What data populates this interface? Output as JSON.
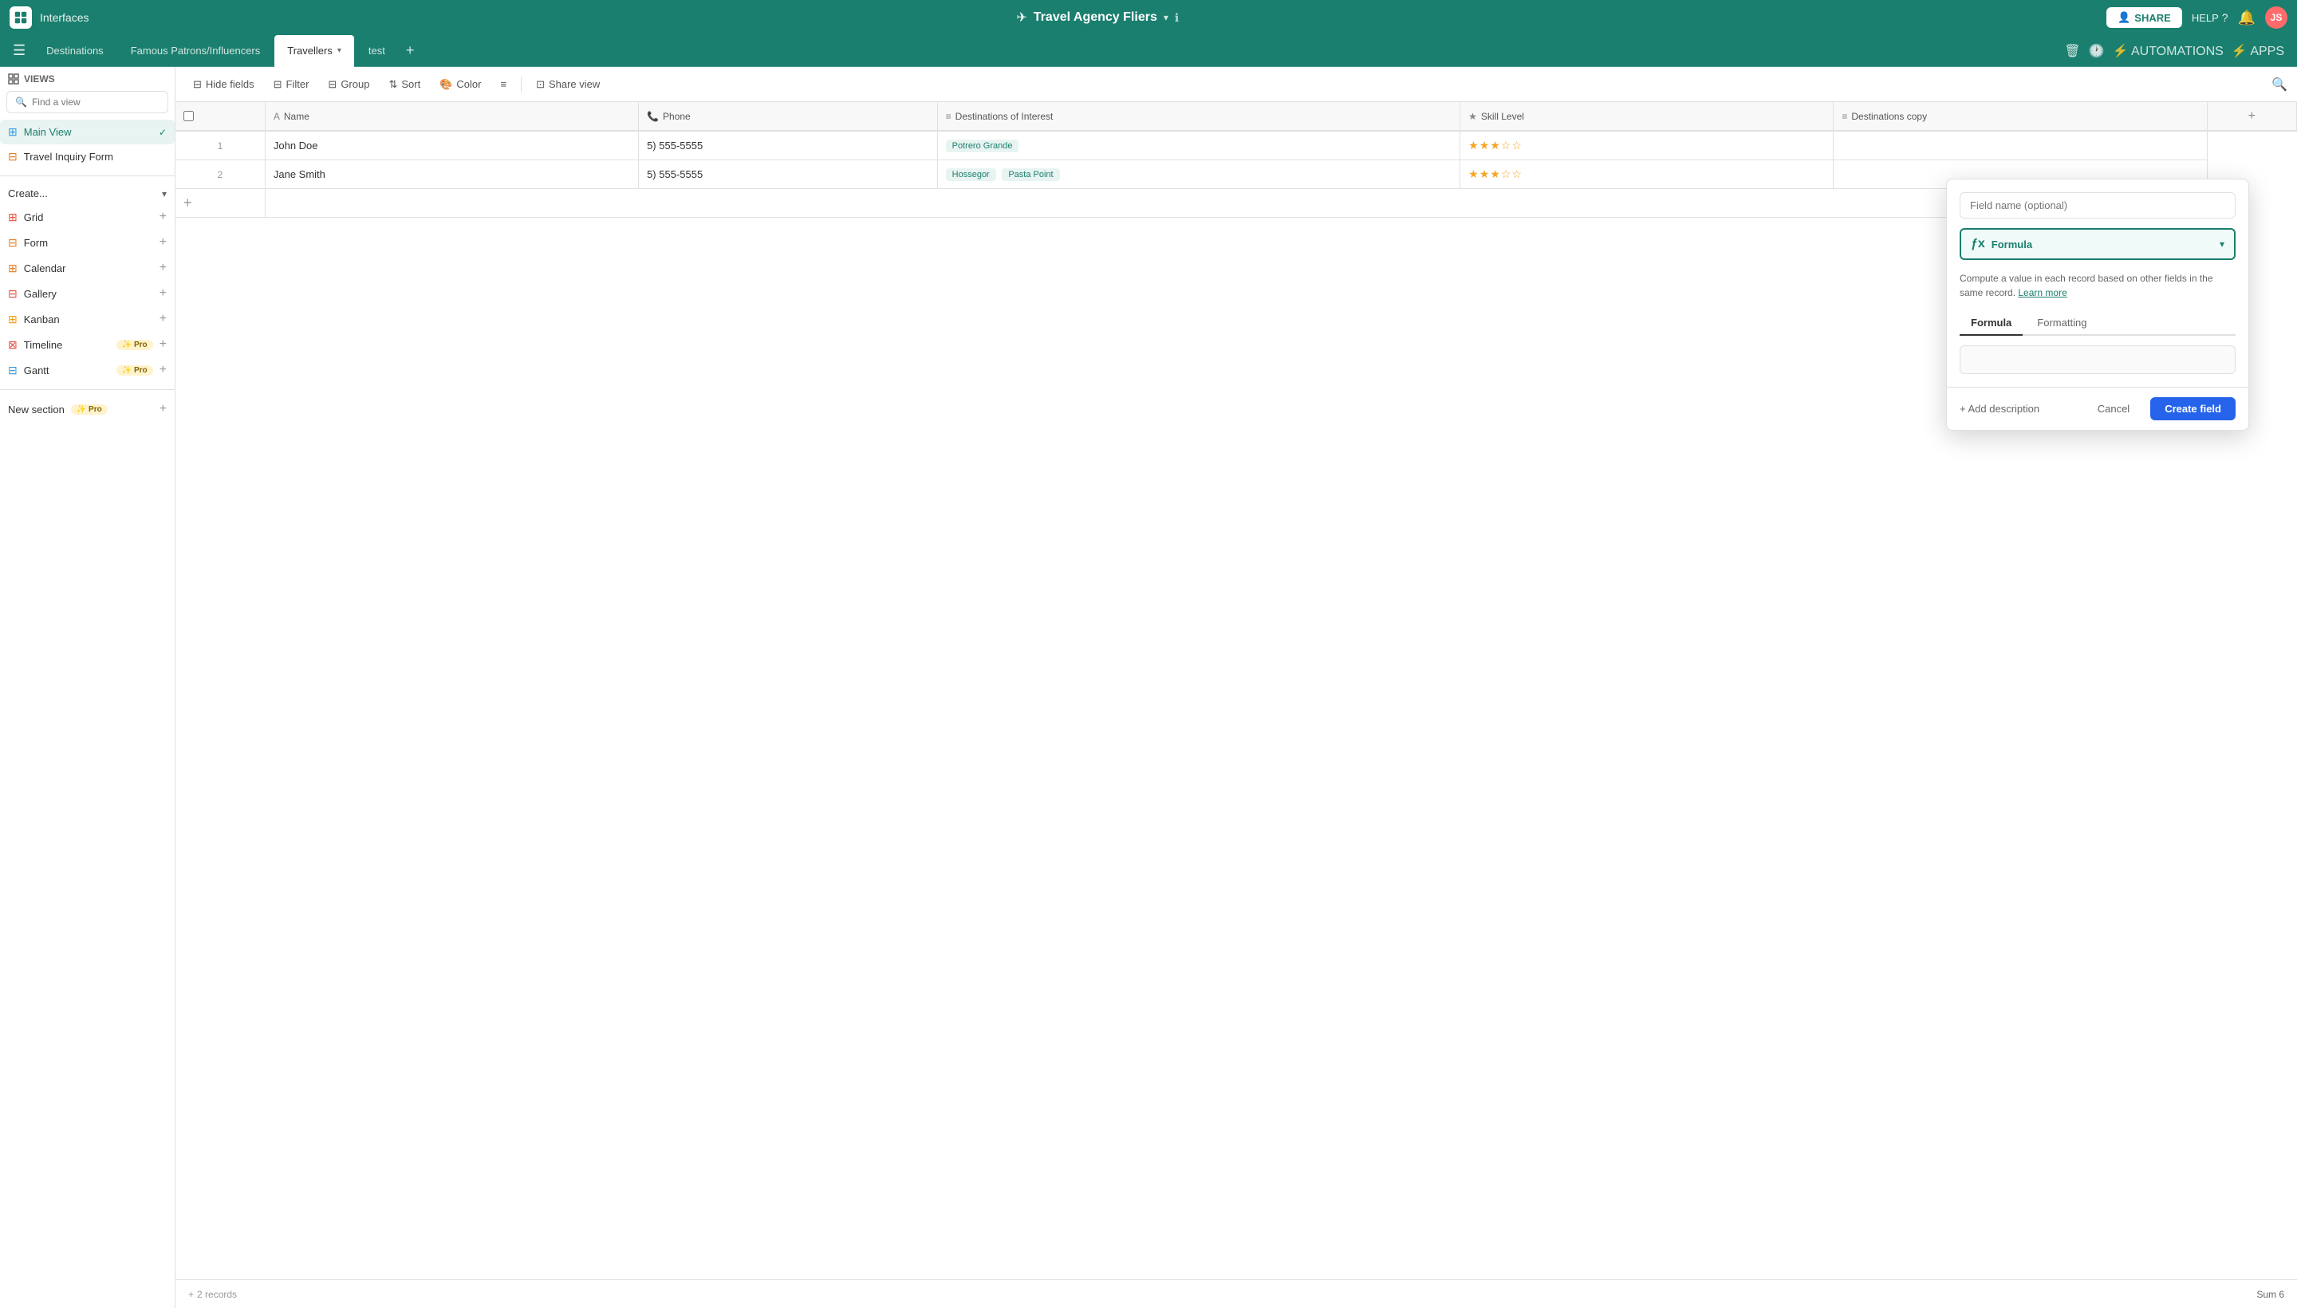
{
  "app": {
    "name": "Interfaces",
    "project_title": "Travel Agency Fliers",
    "info_icon": "ℹ",
    "plane_icon": "✈"
  },
  "topbar": {
    "share_label": "SHARE",
    "help_label": "HELP",
    "avatar_initials": "JS"
  },
  "tabs": [
    {
      "id": "destinations",
      "label": "Destinations",
      "active": false
    },
    {
      "id": "famous",
      "label": "Famous Patrons/Influencers",
      "active": false
    },
    {
      "id": "travellers",
      "label": "Travellers",
      "active": true,
      "has_dropdown": true
    },
    {
      "id": "test",
      "label": "test",
      "active": false
    }
  ],
  "toolbar": {
    "views_label": "VIEWS",
    "main_view_label": "Main View",
    "hide_fields_label": "Hide fields",
    "filter_label": "Filter",
    "group_label": "Group",
    "sort_label": "Sort",
    "color_label": "Color",
    "share_view_label": "Share view"
  },
  "sidebar": {
    "find_placeholder": "Find a view",
    "views": [
      {
        "id": "main-view",
        "label": "Main View",
        "type": "grid",
        "active": true
      },
      {
        "id": "inquiry-form",
        "label": "Travel Inquiry Form",
        "type": "form",
        "active": false
      }
    ],
    "create_label": "Create...",
    "create_items": [
      {
        "id": "grid",
        "label": "Grid",
        "color": "#e74c3c"
      },
      {
        "id": "form",
        "label": "Form",
        "color": "#e67e22"
      },
      {
        "id": "calendar",
        "label": "Calendar",
        "color": "#e67e22"
      },
      {
        "id": "gallery",
        "label": "Gallery",
        "color": "#e74c3c"
      },
      {
        "id": "kanban",
        "label": "Kanban",
        "color": "#f39c12"
      },
      {
        "id": "timeline",
        "label": "Timeline",
        "color": "#e74c3c",
        "pro": true
      },
      {
        "id": "gantt",
        "label": "Gantt",
        "color": "#3498db",
        "pro": true
      }
    ],
    "new_section_label": "New section",
    "new_section_pro": true
  },
  "grid": {
    "columns": [
      {
        "id": "check",
        "label": ""
      },
      {
        "id": "name",
        "label": "Name",
        "icon": "A"
      },
      {
        "id": "phone",
        "label": "Phone",
        "icon": "📞"
      },
      {
        "id": "destinations",
        "label": "Destinations of Interest",
        "icon": "≡"
      },
      {
        "id": "skill",
        "label": "Skill Level",
        "icon": "★"
      },
      {
        "id": "destinations_copy",
        "label": "Destinations copy",
        "icon": "≡"
      }
    ],
    "rows": [
      {
        "row_num": "1",
        "name": "John Doe",
        "phone": "5) 555-5555",
        "destinations": [
          "Potrero Grande"
        ],
        "skill_stars": 3,
        "destinations_copy": ""
      },
      {
        "row_num": "2",
        "name": "Jane Smith",
        "phone": "5) 555-5555",
        "destinations": [
          "Hossegor",
          "Pasta Point"
        ],
        "skill_stars": 3,
        "destinations_copy": ""
      }
    ],
    "footer": {
      "records_label": "2 records",
      "sum_label": "Sum 6"
    }
  },
  "popup": {
    "field_name_placeholder": "Field name (optional)",
    "field_type_label": "Formula",
    "field_type_icon": "f(x)",
    "description": "Compute a value in each record based on other fields in the same record.",
    "learn_more": "Learn more",
    "tabs": [
      {
        "id": "formula",
        "label": "Formula",
        "active": true
      },
      {
        "id": "formatting",
        "label": "Formatting",
        "active": false
      }
    ],
    "formula_placeholder": "",
    "add_description_label": "+ Add description",
    "cancel_label": "Cancel",
    "create_field_label": "Create field"
  }
}
